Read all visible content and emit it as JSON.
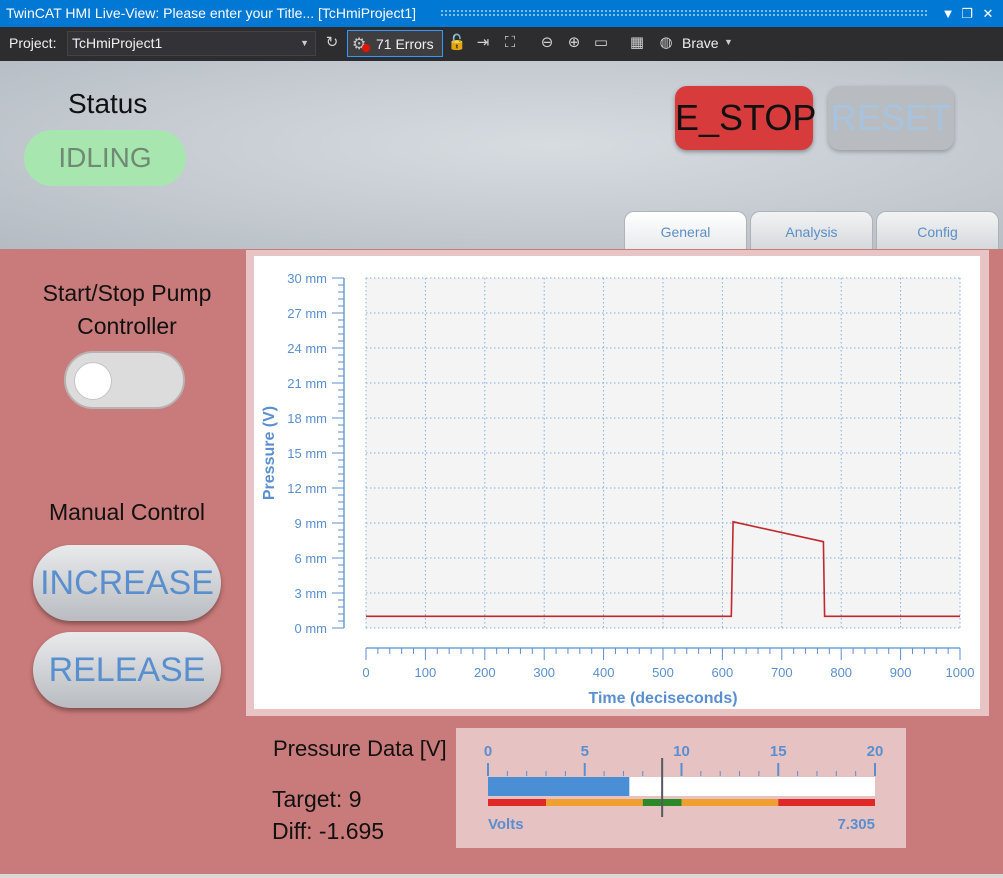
{
  "window": {
    "title": "TwinCAT HMI Live-View: Please enter your Title... [TcHmiProject1]",
    "buttons": [
      "▼",
      "❐",
      "✕"
    ]
  },
  "toolbar": {
    "project_label": "Project:",
    "project_value": "TcHmiProject1",
    "errors_label": "71 Errors",
    "browser_label": "Brave",
    "icons": [
      "refresh-icon",
      "unlock-icon",
      "login-icon",
      "fullscreen-icon",
      "zoom-out-icon",
      "zoom-in-icon",
      "zoom-reset-icon",
      "qr-code-icon",
      "browser-globe-icon"
    ]
  },
  "header": {
    "status_label": "Status",
    "status_value": "IDLING",
    "estop_label": "E_STOP",
    "reset_label": "RESET",
    "tabs": [
      {
        "label": "General",
        "active": true
      },
      {
        "label": "Analysis",
        "active": false
      },
      {
        "label": "Config",
        "active": false
      }
    ]
  },
  "controls": {
    "pump_label": "Start/Stop Pump Controller",
    "pump_on": false,
    "manual_label": "Manual Control",
    "increase_label": "INCREASE",
    "release_label": "RELEASE"
  },
  "colors": {
    "accent_blue": "#5a8fcf",
    "estop_red": "#d83b3b",
    "status_green": "#a8e6b0",
    "panel_bg": "#c97a7a",
    "trace": "#c0282c"
  },
  "chart_data": {
    "type": "line",
    "xlabel": "Time (deciseconds)",
    "ylabel": "Pressure (V)",
    "xlim": [
      0,
      1000
    ],
    "ylim": [
      0,
      30
    ],
    "x_ticks": [
      0,
      100,
      200,
      300,
      400,
      500,
      600,
      700,
      800,
      900,
      1000
    ],
    "y_ticks": [
      "0 mm",
      "3 mm",
      "6 mm",
      "9 mm",
      "12 mm",
      "15 mm",
      "18 mm",
      "21 mm",
      "24 mm",
      "27 mm",
      "30 mm"
    ],
    "grid": true,
    "series": [
      {
        "x": [
          0,
          615,
          618,
          770,
          772,
          1000
        ],
        "y": [
          1.0,
          1.0,
          9.1,
          7.4,
          1.0,
          1.0
        ]
      }
    ]
  },
  "pressure": {
    "title": "Pressure Data [V]",
    "target_text": "Target: 9",
    "diff_text": "Diff: -1.695"
  },
  "gauge": {
    "min": 0,
    "max": 20,
    "ticks": [
      "0",
      "5",
      "10",
      "15",
      "20"
    ],
    "value": 7.305,
    "value_text": "7.305",
    "target": 9,
    "unit_label": "Volts",
    "bands": [
      {
        "from": 0,
        "to": 3,
        "color": "#e02828"
      },
      {
        "from": 3,
        "to": 8,
        "color": "#f0a030"
      },
      {
        "from": 8,
        "to": 10,
        "color": "#2a8a2a"
      },
      {
        "from": 10,
        "to": 15,
        "color": "#f0a030"
      },
      {
        "from": 15,
        "to": 20,
        "color": "#e02828"
      }
    ]
  }
}
